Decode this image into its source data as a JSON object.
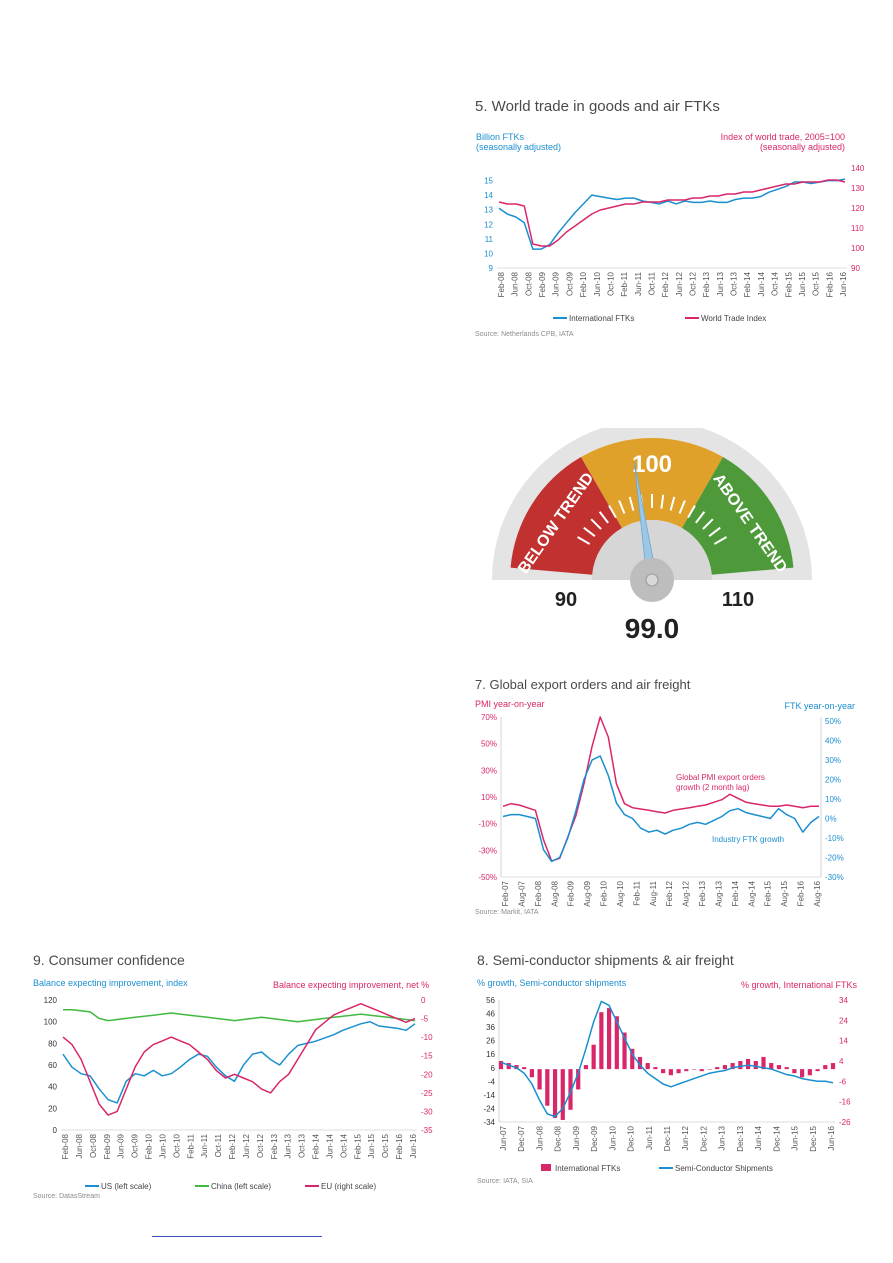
{
  "charts": {
    "c5": {
      "title": "5. World trade in goods and air FTKs",
      "left_label_1": "Billion FTKs",
      "left_label_2": "(seasonally adjusted)",
      "right_label_1": "Index of world trade, 2005=100",
      "right_label_2": "(seasonally adjusted)",
      "source": "Source: Netherlands CPB, IATA"
    },
    "gauge": {
      "low": "90",
      "mid": "100",
      "high": "110",
      "value_text": "99.0",
      "below": "BELOW TREND",
      "above": "ABOVE TREND"
    },
    "c7": {
      "title": "7. Global export orders and air freight",
      "left_label": "PMI year-on-year",
      "right_label": "FTK year-on-year",
      "annotation_1": "Global PMI export orders",
      "annotation_2": "growth (2 month lag)",
      "annotation_3": "Industry FTK growth",
      "source": "Source: Markit, IATA"
    },
    "c9": {
      "title": "9. Consumer confidence",
      "left_label": "Balance expecting improvement, index",
      "right_label": "Balance expecting improvement, net %",
      "source": "Source: DatasStream"
    },
    "c8": {
      "title": "8. Semi-conductor shipments & air freight",
      "left_label": "% growth, Semi-conductor shipments",
      "right_label": "% growth, International FTKs",
      "source": "Source: IATA, SIA"
    }
  },
  "chart_data": [
    {
      "type": "line",
      "title": "5. World trade in goods and air FTKs",
      "x_ticks": [
        "Feb-08",
        "Jun-08",
        "Oct-08",
        "Feb-09",
        "Jun-09",
        "Oct-09",
        "Feb-10",
        "Jun-10",
        "Oct-10",
        "Feb-11",
        "Jun-11",
        "Oct-11",
        "Feb-12",
        "Jun-12",
        "Oct-12",
        "Feb-13",
        "Jun-13",
        "Oct-13",
        "Feb-14",
        "Jun-14",
        "Oct-14",
        "Feb-15",
        "Jun-15",
        "Oct-15",
        "Feb-16",
        "Jun-16"
      ],
      "y_ticks_left": [
        "9",
        "10",
        "11",
        "12",
        "13",
        "14",
        "15"
      ],
      "y_ticks_right": [
        "90",
        "100",
        "110",
        "120",
        "130",
        "140"
      ],
      "ylim_left": [
        9,
        16
      ],
      "ylim_right": [
        90,
        141
      ],
      "series": [
        {
          "name": "International FTKs",
          "axis": "left",
          "color": "#1a8fd0",
          "values": [
            13.1,
            12.7,
            12.5,
            12.1,
            10.3,
            10.3,
            10.6,
            11.4,
            12.1,
            12.8,
            13.4,
            14.0,
            13.9,
            13.8,
            13.7,
            13.8,
            13.8,
            13.6,
            13.5,
            13.4,
            13.6,
            13.4,
            13.6,
            13.5,
            13.5,
            13.6,
            13.5,
            13.5,
            13.7,
            13.8,
            13.8,
            13.9,
            14.2,
            14.4,
            14.6,
            14.9,
            14.9,
            14.8,
            14.9,
            15.0,
            15.0,
            15.1
          ]
        },
        {
          "name": "World Trade Index",
          "axis": "right",
          "color": "#d9266a",
          "values": [
            123,
            122,
            122,
            121,
            102,
            101,
            101,
            104,
            108,
            111,
            114,
            117,
            119,
            120,
            121,
            122,
            122,
            123,
            123,
            123,
            124,
            124,
            124,
            125,
            125,
            126,
            126,
            127,
            127,
            128,
            128,
            129,
            130,
            131,
            132,
            132,
            133,
            133,
            133,
            134,
            134,
            133
          ]
        }
      ]
    },
    {
      "type": "gauge",
      "min": 90,
      "max": 110,
      "value": 99.0
    },
    {
      "type": "line",
      "title": "7. Global export orders and air freight",
      "x_ticks": [
        "Feb-07",
        "Aug-07",
        "Feb-08",
        "Aug-08",
        "Feb-09",
        "Aug-09",
        "Feb-10",
        "Aug-10",
        "Feb-11",
        "Aug-11",
        "Feb-12",
        "Aug-12",
        "Feb-13",
        "Aug-13",
        "Feb-14",
        "Aug-14",
        "Feb-15",
        "Aug-15",
        "Feb-16",
        "Aug-16"
      ],
      "y_ticks_left": [
        "70%",
        "50%",
        "30%",
        "10%",
        "-10%",
        "-30%",
        "-50%"
      ],
      "y_ticks_right": [
        "50%",
        "40%",
        "30%",
        "20%",
        "10%",
        "0%",
        "-10%",
        "-20%",
        "-30%"
      ],
      "ylim_left": [
        -50,
        70
      ],
      "ylim_right": [
        -30,
        52
      ],
      "series": [
        {
          "name": "Global PMI export orders growth (2 month lag)",
          "axis": "left",
          "color": "#d9266a",
          "values": [
            3,
            5,
            4,
            2,
            0,
            -22,
            -38,
            -36,
            -20,
            -4,
            20,
            48,
            70,
            55,
            20,
            5,
            2,
            1,
            0,
            -1,
            -2,
            0,
            1,
            2,
            3,
            4,
            6,
            8,
            12,
            9,
            6,
            5,
            4,
            3,
            3,
            4,
            3,
            2,
            3,
            3
          ]
        },
        {
          "name": "Industry FTK growth",
          "axis": "right",
          "color": "#1a8fd0",
          "values": [
            1,
            2,
            2,
            1,
            0,
            -16,
            -22,
            -20,
            -10,
            4,
            20,
            30,
            32,
            22,
            8,
            2,
            0,
            -5,
            -7,
            -6,
            -8,
            -6,
            -5,
            -3,
            -2,
            -3,
            -1,
            1,
            4,
            5,
            3,
            2,
            1,
            0,
            5,
            2,
            0,
            -7,
            -2,
            1
          ]
        }
      ]
    },
    {
      "type": "line",
      "title": "9. Consumer confidence",
      "x_ticks": [
        "Feb-08",
        "Jun-08",
        "Oct-08",
        "Feb-09",
        "Jun-09",
        "Oct-09",
        "Feb-10",
        "Jun-10",
        "Oct-10",
        "Feb-11",
        "Jun-11",
        "Oct-11",
        "Feb-12",
        "Jun-12",
        "Oct-12",
        "Feb-13",
        "Jun-13",
        "Oct-13",
        "Feb-14",
        "Jun-14",
        "Oct-14",
        "Feb-15",
        "Jun-15",
        "Oct-15",
        "Feb-16",
        "Jun-16"
      ],
      "y_ticks_left": [
        "0",
        "20",
        "40",
        "60",
        "80",
        "100",
        "120"
      ],
      "y_ticks_right": [
        "0",
        "-5",
        "-10",
        "-15",
        "-20",
        "-25",
        "-30",
        "-35"
      ],
      "ylim_left": [
        0,
        120
      ],
      "ylim_right": [
        -35,
        0
      ],
      "series": [
        {
          "name": "US (left scale)",
          "axis": "left",
          "color": "#1a8fd0",
          "values": [
            70,
            58,
            52,
            50,
            38,
            28,
            25,
            45,
            52,
            50,
            55,
            50,
            52,
            58,
            65,
            70,
            68,
            58,
            50,
            45,
            60,
            70,
            72,
            65,
            60,
            70,
            78,
            80,
            82,
            85,
            88,
            92,
            95,
            98,
            100,
            96,
            95,
            94,
            92,
            98
          ]
        },
        {
          "name": "China (left scale)",
          "axis": "left",
          "color": "#3fba3f",
          "values": [
            111,
            111,
            110,
            109,
            103,
            101,
            102,
            103,
            104,
            105,
            106,
            107,
            108,
            107,
            106,
            105,
            104,
            103,
            102,
            101,
            102,
            103,
            104,
            103,
            102,
            101,
            100,
            101,
            102,
            103,
            104,
            105,
            106,
            107,
            106,
            105,
            104,
            103,
            102,
            101
          ]
        },
        {
          "name": "EU (right scale)",
          "axis": "right",
          "color": "#d9266a",
          "values": [
            -10,
            -12,
            -16,
            -22,
            -28,
            -31,
            -30,
            -24,
            -18,
            -14,
            -12,
            -11,
            -10,
            -11,
            -12,
            -14,
            -16,
            -19,
            -21,
            -20,
            -21,
            -22,
            -24,
            -25,
            -22,
            -20,
            -16,
            -12,
            -8,
            -6,
            -4,
            -3,
            -2,
            -1,
            -2,
            -3,
            -4,
            -5,
            -6,
            -5
          ]
        }
      ]
    },
    {
      "type": "bar",
      "title": "8. Semi-conductor shipments & air freight",
      "x_ticks": [
        "Jun-07",
        "Dec-07",
        "Jun-08",
        "Dec-08",
        "Jun-09",
        "Dec-09",
        "Jun-10",
        "Dec-10",
        "Jun-11",
        "Dec-11",
        "Jun-12",
        "Dec-12",
        "Jun-13",
        "Dec-13",
        "Jun-14",
        "Dec-14",
        "Jun-15",
        "Dec-15",
        "Jun-16"
      ],
      "y_ticks_left": [
        "56",
        "46",
        "36",
        "26",
        "16",
        "6",
        "-4",
        "-14",
        "-24",
        "-34"
      ],
      "y_ticks_right": [
        "34",
        "24",
        "14",
        "4",
        "-6",
        "-16",
        "-26"
      ],
      "ylim_left": [
        -34,
        56
      ],
      "ylim_right": [
        -26,
        34
      ],
      "series": [
        {
          "name": "International FTKs",
          "axis": "right",
          "type": "bar",
          "color": "#d9266a",
          "values": [
            4,
            3,
            2,
            1,
            -4,
            -10,
            -18,
            -24,
            -25,
            -20,
            -10,
            2,
            12,
            28,
            30,
            26,
            18,
            10,
            6,
            3,
            1,
            -2,
            -3,
            -2,
            -1,
            0,
            -1,
            0,
            1,
            2,
            3,
            4,
            5,
            4,
            6,
            3,
            2,
            1,
            -2,
            -4,
            -3,
            -1,
            2,
            3
          ]
        },
        {
          "name": "Semi-Conductor Shipments",
          "axis": "left",
          "type": "line",
          "color": "#1a8fd0",
          "values": [
            10,
            8,
            6,
            2,
            -6,
            -18,
            -28,
            -30,
            -24,
            -12,
            2,
            20,
            40,
            55,
            52,
            40,
            28,
            16,
            8,
            2,
            -2,
            -6,
            -8,
            -6,
            -4,
            -2,
            0,
            2,
            3,
            4,
            6,
            7,
            8,
            7,
            6,
            5,
            3,
            1,
            0,
            -2,
            -3,
            -4,
            -4,
            -5
          ]
        }
      ]
    }
  ]
}
